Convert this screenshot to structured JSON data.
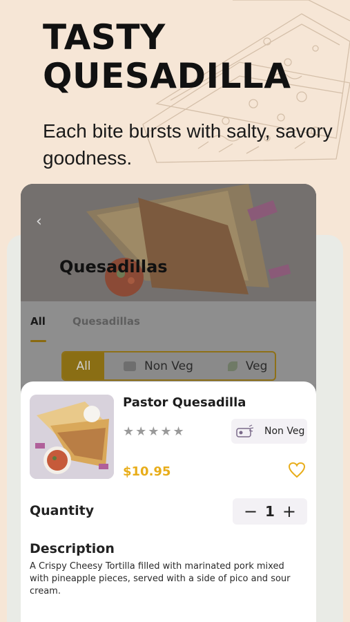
{
  "promo": {
    "headline_line1": "TASTY",
    "headline_line2": "QUESADILLA",
    "subline": "Each bite bursts with salty, savory goodness."
  },
  "screen": {
    "hero_title": "Quesadillas",
    "back_icon": "chevron-left-icon",
    "tabs": [
      {
        "label": "All",
        "active": true
      },
      {
        "label": "Quesadillas",
        "active": false
      }
    ],
    "filter": {
      "options": [
        {
          "label": "All",
          "selected": true
        },
        {
          "label": "Non Veg",
          "icon": "meat-icon"
        },
        {
          "label": "Veg",
          "icon": "leaf-icon"
        }
      ]
    }
  },
  "item": {
    "title": "Pastor Quesadilla",
    "stars": "★★★★★",
    "rating": 0,
    "max_rating": 5,
    "badge_label": "Non Veg",
    "price": "$10.95",
    "favorite": false,
    "quantity_label": "Quantity",
    "quantity": "1",
    "minus": "−",
    "plus": "+",
    "description_title": "Description",
    "description": "A Crispy Cheesy Tortilla filled with marinated pork mixed with pineapple pieces, served with a side of pico and sour cream."
  },
  "colors": {
    "background": "#f6e6d6",
    "accent": "#e8ad1a",
    "card": "#ffffff"
  }
}
